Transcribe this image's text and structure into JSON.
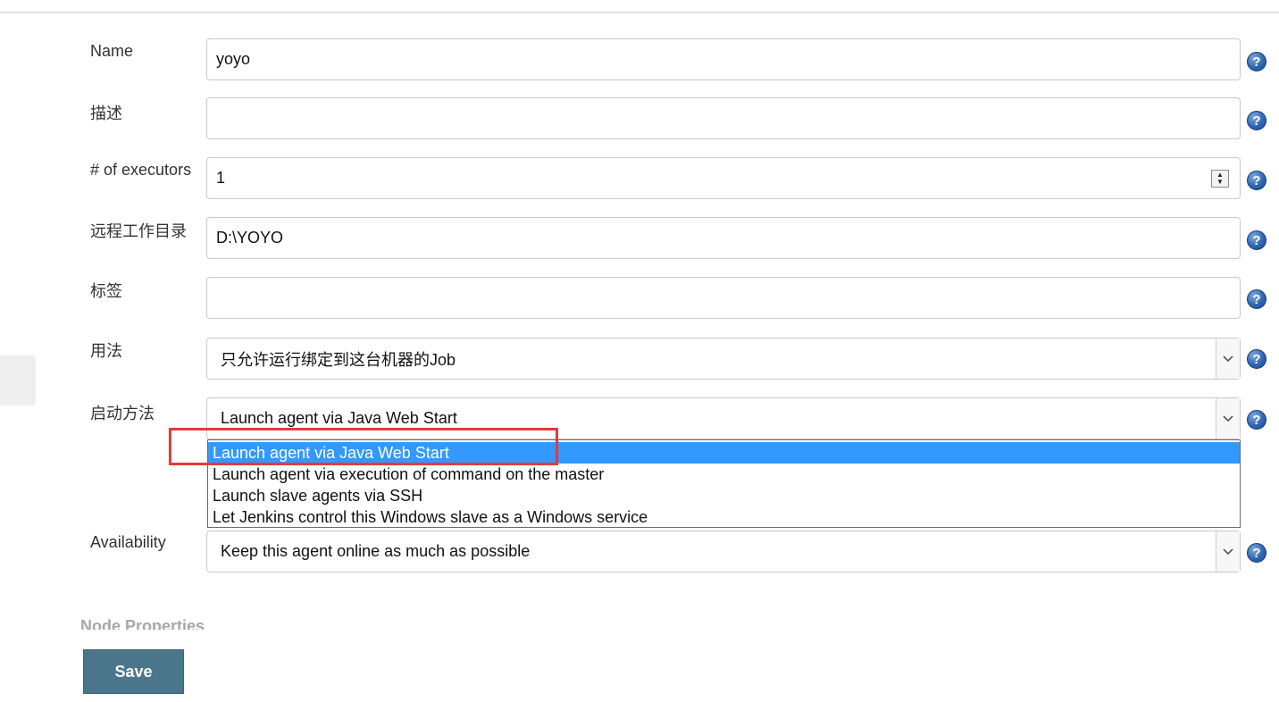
{
  "form": {
    "name": {
      "label": "Name",
      "value": "yoyo"
    },
    "description": {
      "label": "描述",
      "value": ""
    },
    "executors": {
      "label": "# of executors",
      "value": "1"
    },
    "remote_dir": {
      "label": "远程工作目录",
      "value": "D:\\YOYO"
    },
    "labels": {
      "label": "标签",
      "value": ""
    },
    "usage": {
      "label": "用法",
      "value": "只允许运行绑定到这台机器的Job"
    },
    "launch_method": {
      "label": "启动方法",
      "value": "Launch agent via Java Web Start",
      "options": [
        "Launch agent via Java Web Start",
        "Launch agent via execution of command on the master",
        "Launch slave agents via SSH",
        "Let Jenkins control this Windows slave as a Windows service"
      ],
      "selected_index": 0
    },
    "availability": {
      "label": "Availability",
      "value": "Keep this agent online as much as possible"
    }
  },
  "section": {
    "node_properties": "Node Properties"
  },
  "help_glyph": "?",
  "save_label": "Save",
  "colors": {
    "highlight": "#3399ff",
    "annotation": "#e23b3b",
    "button": "#4b758b"
  }
}
